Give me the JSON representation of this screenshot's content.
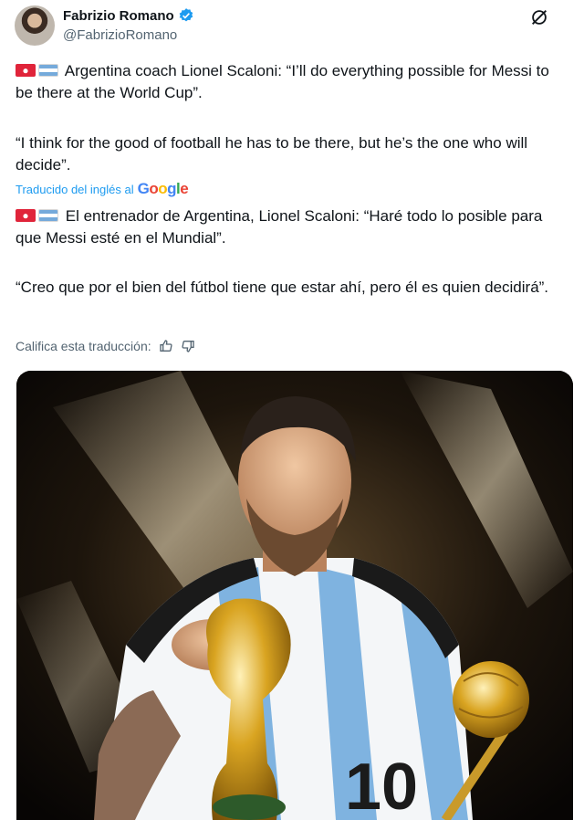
{
  "author": {
    "name": "Fabrizio Romano",
    "handle": "@FabrizioRomano"
  },
  "icons": {
    "verified": "verified-badge-icon",
    "grok": "grok-icon",
    "siren": "rotating-light-emoji",
    "flag": "argentina-flag-emoji",
    "thumbs_up": "thumbs-up-icon",
    "thumbs_down": "thumbs-down-icon"
  },
  "tweet": {
    "original_p1": "Argentina coach Lionel Scaloni: “I’ll do everything possible for Messi to be there at the World Cup”.",
    "original_p2": "“I think for the good of football he has to be there, but he’s the one who will decide”.",
    "translated_label": "Traducido del inglés al",
    "translated_brand": "Google",
    "translation_p1": "El entrenador de Argentina, Lionel Scaloni: “Haré todo lo posible para que Messi esté en el Mundial”.",
    "translation_p2": "“Creo que por el bien del fútbol tiene que estar ahí, pero él es quien decidirá”.",
    "rate_label": "Califica esta traducción:"
  },
  "colors": {
    "link": "#1d9bf0",
    "secondary": "#536471",
    "verified": "#1d9bf0"
  }
}
